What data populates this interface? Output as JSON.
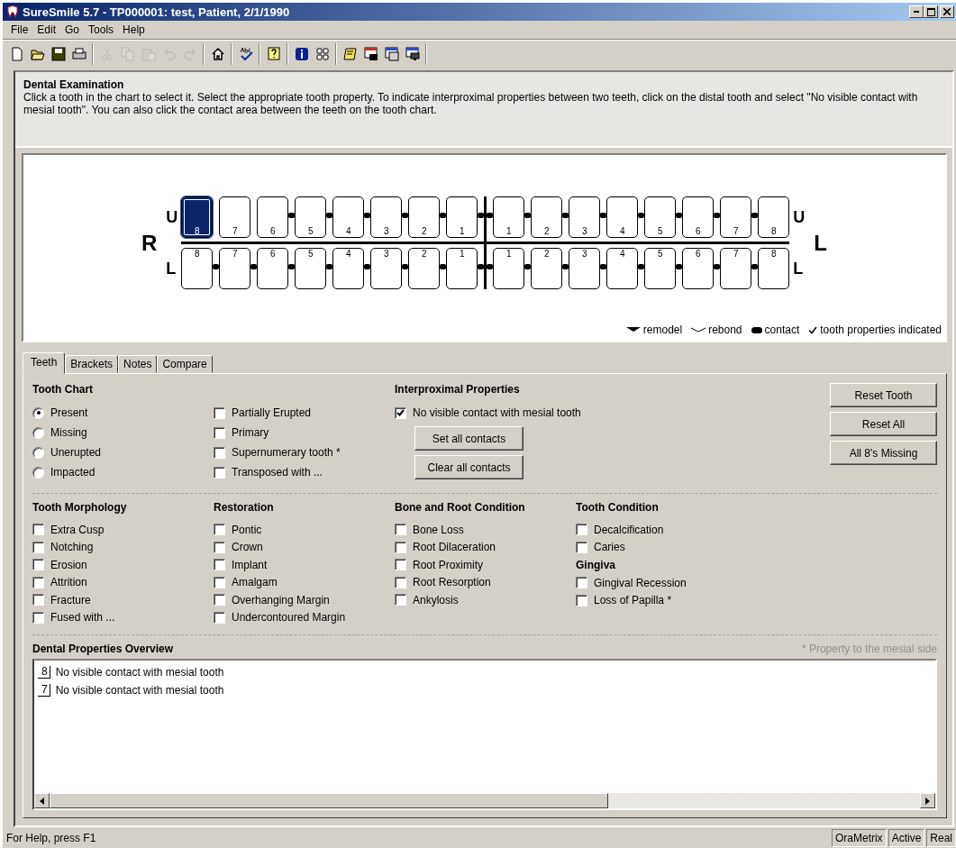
{
  "window": {
    "title": "SureSmile 5.7 - TP000001: test, Patient, 2/1/1990"
  },
  "menu": [
    {
      "label": "File"
    },
    {
      "label": "Edit"
    },
    {
      "label": "Go"
    },
    {
      "label": "Tools"
    },
    {
      "label": "Help"
    }
  ],
  "toolbar": [
    {
      "kind": "new",
      "disabled": false
    },
    {
      "kind": "open",
      "disabled": false
    },
    {
      "kind": "save",
      "disabled": false
    },
    {
      "kind": "print",
      "disabled": false
    },
    {
      "kind": "sep"
    },
    {
      "kind": "cut",
      "disabled": true
    },
    {
      "kind": "copy",
      "disabled": true
    },
    {
      "kind": "paste",
      "disabled": true
    },
    {
      "kind": "undo",
      "disabled": true
    },
    {
      "kind": "redo",
      "disabled": true
    },
    {
      "kind": "sep"
    },
    {
      "kind": "home",
      "disabled": false
    },
    {
      "kind": "sep"
    },
    {
      "kind": "spell",
      "disabled": false
    },
    {
      "kind": "sep"
    },
    {
      "kind": "help",
      "disabled": false
    },
    {
      "kind": "sep"
    },
    {
      "kind": "info",
      "disabled": false
    },
    {
      "kind": "grid",
      "disabled": false
    },
    {
      "kind": "sep"
    },
    {
      "kind": "notes",
      "disabled": false
    },
    {
      "kind": "camera",
      "disabled": false
    },
    {
      "kind": "image",
      "disabled": false
    },
    {
      "kind": "monitor",
      "disabled": false
    },
    {
      "kind": "sep"
    }
  ],
  "header": {
    "title": "Dental Examination",
    "text": "Click a tooth in the chart to select it.  Select the appropriate tooth property.  To indicate interproximal properties between two teeth, click on the distal tooth and select \"No visible contact with mesial tooth\".  You can also click the contact area between the teeth on the tooth chart."
  },
  "chart": {
    "right_side": {
      "side": "R",
      "upper": "U",
      "lower": "L"
    },
    "left_side": {
      "side": "L",
      "upper": "U",
      "lower": "L"
    },
    "upper": [
      {
        "number": "8",
        "selected": true,
        "contact": false
      },
      {
        "number": "7",
        "selected": false,
        "contact": false
      },
      {
        "number": "6",
        "selected": false,
        "contact": true
      },
      {
        "number": "5",
        "selected": false,
        "contact": true
      },
      {
        "number": "4",
        "selected": false,
        "contact": true
      },
      {
        "number": "3",
        "selected": false,
        "contact": true
      },
      {
        "number": "2",
        "selected": false,
        "contact": true
      },
      {
        "number": "1",
        "selected": false,
        "contact": true
      },
      {
        "number": "1",
        "selected": false,
        "contact": true
      },
      {
        "number": "2",
        "selected": false,
        "contact": true
      },
      {
        "number": "3",
        "selected": false,
        "contact": true
      },
      {
        "number": "4",
        "selected": false,
        "contact": true
      },
      {
        "number": "5",
        "selected": false,
        "contact": true
      },
      {
        "number": "6",
        "selected": false,
        "contact": true
      },
      {
        "number": "7",
        "selected": false,
        "contact": true
      },
      {
        "number": "8",
        "selected": false,
        "contact": true
      }
    ],
    "lower": [
      {
        "number": "8",
        "selected": false,
        "contact": true
      },
      {
        "number": "7",
        "selected": false,
        "contact": true
      },
      {
        "number": "6",
        "selected": false,
        "contact": true
      },
      {
        "number": "5",
        "selected": false,
        "contact": true
      },
      {
        "number": "4",
        "selected": false,
        "contact": true
      },
      {
        "number": "3",
        "selected": false,
        "contact": true
      },
      {
        "number": "2",
        "selected": false,
        "contact": true
      },
      {
        "number": "1",
        "selected": false,
        "contact": true
      },
      {
        "number": "1",
        "selected": false,
        "contact": true
      },
      {
        "number": "2",
        "selected": false,
        "contact": true
      },
      {
        "number": "3",
        "selected": false,
        "contact": true
      },
      {
        "number": "4",
        "selected": false,
        "contact": true
      },
      {
        "number": "5",
        "selected": false,
        "contact": true
      },
      {
        "number": "6",
        "selected": false,
        "contact": true
      },
      {
        "number": "7",
        "selected": false,
        "contact": true
      },
      {
        "number": "8",
        "selected": false,
        "contact": true
      }
    ],
    "legend": [
      {
        "kind": "remodel",
        "label": "remodel"
      },
      {
        "kind": "rebond",
        "label": "rebond"
      },
      {
        "kind": "contact",
        "label": "contact"
      },
      {
        "kind": "check",
        "label": "tooth properties indicated"
      }
    ]
  },
  "tabs": [
    {
      "label": "Teeth",
      "selected": true
    },
    {
      "label": "Brackets",
      "selected": false
    },
    {
      "label": "Notes",
      "selected": false
    },
    {
      "label": "Compare",
      "selected": false
    }
  ],
  "tooth_chart": {
    "title": "Tooth Chart",
    "radios": [
      {
        "label": "Present",
        "selected": true
      },
      {
        "label": "Missing",
        "selected": false
      },
      {
        "label": "Unerupted",
        "selected": false
      },
      {
        "label": "Impacted",
        "selected": false
      }
    ],
    "checks": [
      {
        "label": "Partially Erupted",
        "checked": false
      },
      {
        "label": "Primary",
        "checked": false
      },
      {
        "label": "Supernumerary tooth *",
        "checked": false
      },
      {
        "label": "Transposed with ...",
        "checked": false
      }
    ]
  },
  "interproximal": {
    "title": "Interproximal Properties",
    "check": {
      "label": "No visible contact with mesial tooth",
      "checked": true
    },
    "buttons": [
      "Set all contacts",
      "Clear all contacts"
    ]
  },
  "side_buttons": [
    "Reset Tooth",
    "Reset All",
    "All 8's Missing"
  ],
  "groups": [
    {
      "title": "Tooth Morphology",
      "items": [
        {
          "label": "Extra Cusp",
          "checked": false
        },
        {
          "label": "Notching",
          "checked": false
        },
        {
          "label": "Erosion",
          "checked": false
        },
        {
          "label": "Attrition",
          "checked": false
        },
        {
          "label": "Fracture",
          "checked": false
        },
        {
          "label": "Fused with ...",
          "checked": false
        }
      ]
    },
    {
      "title": "Restoration",
      "items": [
        {
          "label": "Pontic",
          "checked": false
        },
        {
          "label": "Crown",
          "checked": false
        },
        {
          "label": "Implant",
          "checked": false
        },
        {
          "label": "Amalgam",
          "checked": false
        },
        {
          "label": "Overhanging Margin",
          "checked": false
        },
        {
          "label": "Undercontoured Margin",
          "checked": false
        }
      ]
    },
    {
      "title": "Bone and Root Condition",
      "items": [
        {
          "label": "Bone Loss",
          "checked": false
        },
        {
          "label": "Root Dilaceration",
          "checked": false
        },
        {
          "label": "Root Proximity",
          "checked": false
        },
        {
          "label": "Root Resorption",
          "checked": false
        },
        {
          "label": "Ankylosis",
          "checked": false
        }
      ]
    },
    {
      "title": "Tooth Condition",
      "items": [
        {
          "label": "Decalcification",
          "checked": false
        },
        {
          "label": "Caries",
          "checked": false
        }
      ],
      "sub": {
        "title": "Gingiva",
        "items": [
          {
            "label": "Gingival Recession",
            "checked": false
          },
          {
            "label": "Loss of Papilla *",
            "checked": false
          }
        ]
      }
    }
  ],
  "overview": {
    "title": "Dental Properties Overview",
    "note": "* Property to the mesial side",
    "items": [
      {
        "tooth": "8",
        "text": "No visible contact with mesial tooth"
      },
      {
        "tooth": "7",
        "text": "No visible contact with mesial tooth"
      }
    ]
  },
  "status_bar": {
    "text": "For Help, press F1",
    "panes": [
      "OraMetrix",
      "Active",
      "Real"
    ]
  }
}
